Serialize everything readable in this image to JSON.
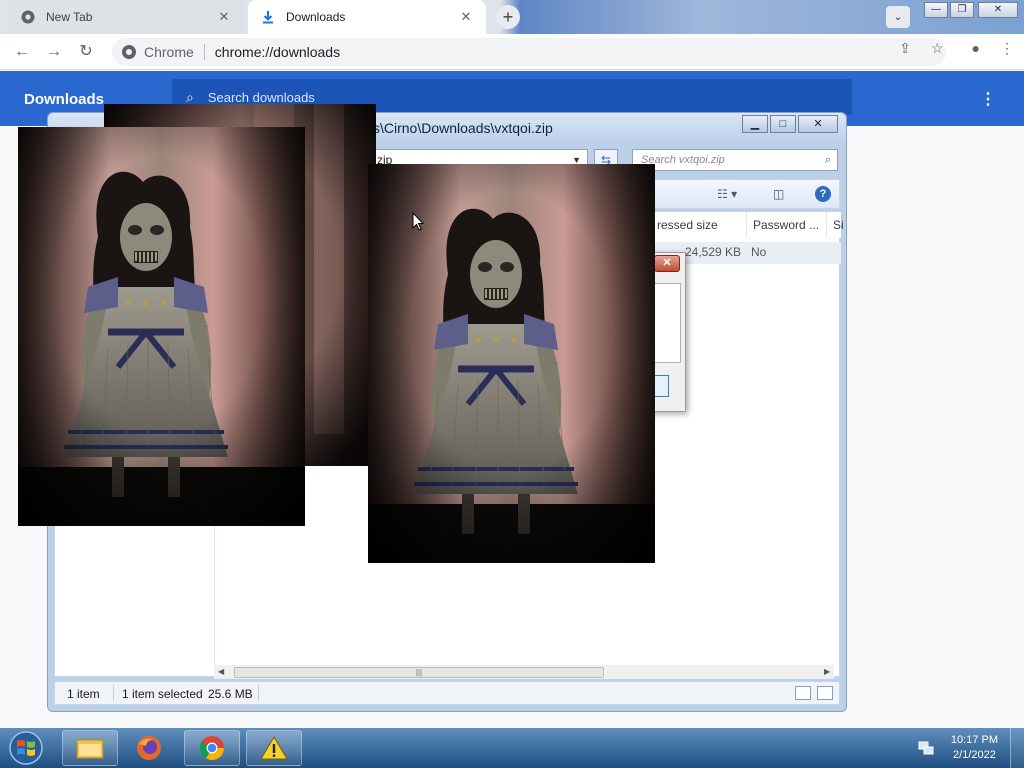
{
  "tabs": [
    {
      "title": "New Tab"
    },
    {
      "title": "Downloads"
    }
  ],
  "toolbar": {
    "site_label": "Chrome",
    "url": "chrome://downloads"
  },
  "downloads_page": {
    "title": "Downloads",
    "search_placeholder": "Search downloads"
  },
  "archive_window": {
    "title": "s\\Cirno\\Downloads\\vxtqoi.zip",
    "address": "zip",
    "search_placeholder": "Search vxtqoi.zip",
    "columns": [
      "ressed size",
      "Password ...",
      "Si"
    ],
    "row": {
      "compressed_size": "24,529 KB",
      "password": "No"
    },
    "status": {
      "items": "1 item",
      "selected": "1 item selected",
      "size": "25.6 MB"
    }
  },
  "taskbar": {
    "time": "10:17 PM",
    "date": "2/1/2022"
  },
  "icons": {
    "chrome": "chrome-icon",
    "download": "download-icon",
    "firefox": "firefox-icon",
    "explorer": "folder-icon",
    "warning": "warning-icon",
    "start": "windows-start-icon"
  },
  "colors": {
    "downloads_header": "#2a67cf",
    "taskbar": "#1f4e80"
  }
}
